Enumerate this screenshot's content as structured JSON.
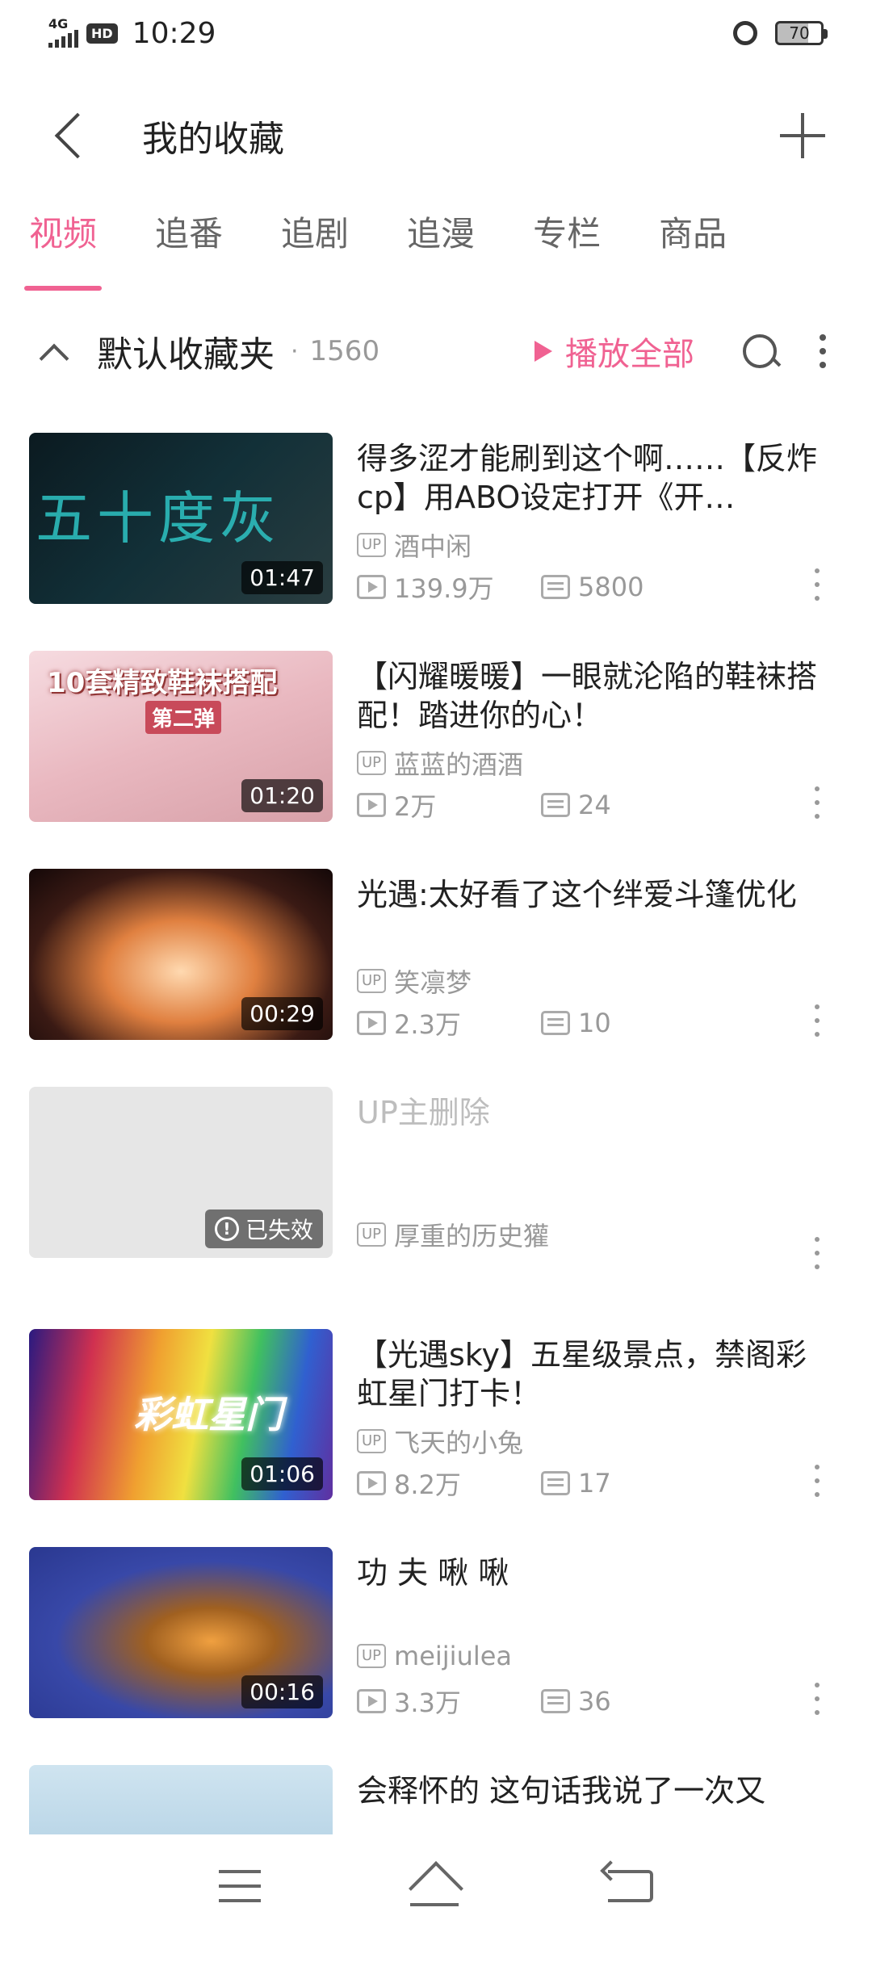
{
  "status_bar": {
    "network": "4G",
    "hd": "HD",
    "time": "10:29",
    "battery": "70"
  },
  "header": {
    "title": "我的收藏"
  },
  "tabs": [
    {
      "label": "视频",
      "active": true
    },
    {
      "label": "追番"
    },
    {
      "label": "追剧"
    },
    {
      "label": "追漫"
    },
    {
      "label": "专栏"
    },
    {
      "label": "商品"
    }
  ],
  "folder": {
    "name": "默认收藏夹",
    "separator": "·",
    "count": "1560",
    "play_all": "播放全部"
  },
  "videos": [
    {
      "title": "得多涩才能刷到这个啊……【反炸cp】用ABO设定打开《开…",
      "duration": "01:47",
      "uploader": "酒中闲",
      "plays": "139.9万",
      "danmaku": "5800",
      "thumb_text": "五十度灰"
    },
    {
      "title": "【闪耀暖暖】一眼就沦陷的鞋袜搭配！踏进你的心！",
      "duration": "01:20",
      "uploader": "蓝蓝的酒酒",
      "plays": "2万",
      "danmaku": "24",
      "thumb_text": "10套精致鞋袜搭配",
      "thumb_sub": "第二弹"
    },
    {
      "title": "光遇:太好看了这个绊爱斗篷优化",
      "duration": "00:29",
      "uploader": "笑凛梦",
      "plays": "2.3万",
      "danmaku": "10"
    },
    {
      "title": "UP主删除",
      "invalid_label": "已失效",
      "uploader": "厚重的历史獾"
    },
    {
      "title": "【光遇sky】五星级景点，禁阁彩虹星门打卡！",
      "duration": "01:06",
      "uploader": "飞天的小兔",
      "plays": "8.2万",
      "danmaku": "17",
      "thumb_text": "彩虹星门"
    },
    {
      "title": "功 夫 啾 啾",
      "duration": "00:16",
      "uploader": "meijiulea",
      "plays": "3.3万",
      "danmaku": "36"
    },
    {
      "title": "会释怀的 这句话我说了一次又"
    }
  ],
  "labels": {
    "up": "UP"
  },
  "colors": {
    "accent": "#f06292"
  }
}
